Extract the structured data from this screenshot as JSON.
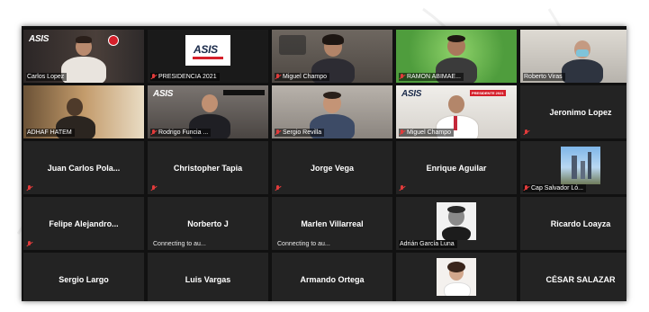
{
  "meeting": {
    "participants": [
      {
        "name": "Carlos Lopez",
        "type": "video",
        "active": true,
        "logo": "ASIS"
      },
      {
        "name": "PRESIDENCIA 2021",
        "type": "video",
        "logo": "ASIS"
      },
      {
        "name": "Miguel Champo",
        "type": "video"
      },
      {
        "name": "RAMON ABIMAE...",
        "type": "video"
      },
      {
        "name": "Roberto Viras",
        "type": "video"
      },
      {
        "name": "ADHAF HATEM",
        "type": "video"
      },
      {
        "name": "Rodrigo Funcia ...",
        "type": "video",
        "logo": "ASIS"
      },
      {
        "name": "Sergio Revilla",
        "type": "video"
      },
      {
        "name": "Miguel Champo",
        "type": "video",
        "logo": "ASIS",
        "banner": "PRESIDENTE 2021"
      },
      {
        "name": "Jeronimo Lopez",
        "type": "name"
      },
      {
        "name": "Juan Carlos Pola...",
        "type": "name"
      },
      {
        "name": "Christopher Tapia",
        "type": "name"
      },
      {
        "name": "Jorge Vega",
        "type": "name"
      },
      {
        "name": "Enrique Aguilar",
        "type": "name"
      },
      {
        "name": "Cap Salvador Ló...",
        "type": "photo"
      },
      {
        "name": "Felipe Alejandro...",
        "type": "name"
      },
      {
        "name": "Norberto J",
        "type": "name",
        "status": "Connecting to au..."
      },
      {
        "name": "Marlen Villarreal",
        "type": "name",
        "status": "Connecting to au..."
      },
      {
        "name": "Adrián García Luna",
        "type": "photo"
      },
      {
        "name": "Ricardo Loayza",
        "type": "name"
      },
      {
        "name": "Sergio Largo",
        "type": "name"
      },
      {
        "name": "Luis Vargas",
        "type": "name"
      },
      {
        "name": "Armando Ortega",
        "type": "name"
      },
      {
        "name": "",
        "type": "photo"
      },
      {
        "name": "CÉSAR SALAZAR",
        "type": "name"
      }
    ]
  },
  "colors": {
    "active_outline": "#d9f45a",
    "muted_mic": "#e23b3b",
    "tile_bg": "#232323",
    "frame_bg": "#111111"
  }
}
